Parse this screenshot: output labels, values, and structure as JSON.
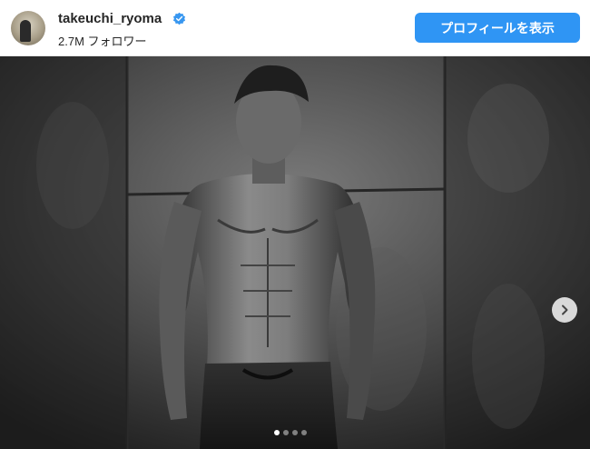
{
  "header": {
    "username": "takeuchi_ryoma",
    "followers": "2.7M フォロワー",
    "profile_button": "プロフィールを表示"
  },
  "icons": {
    "verified": "verified-badge-icon",
    "next": "chevron-right-icon"
  },
  "carousel": {
    "total": 4,
    "active_index": 0
  },
  "colors": {
    "accent": "#2f95f4",
    "verified": "#3897f0"
  }
}
